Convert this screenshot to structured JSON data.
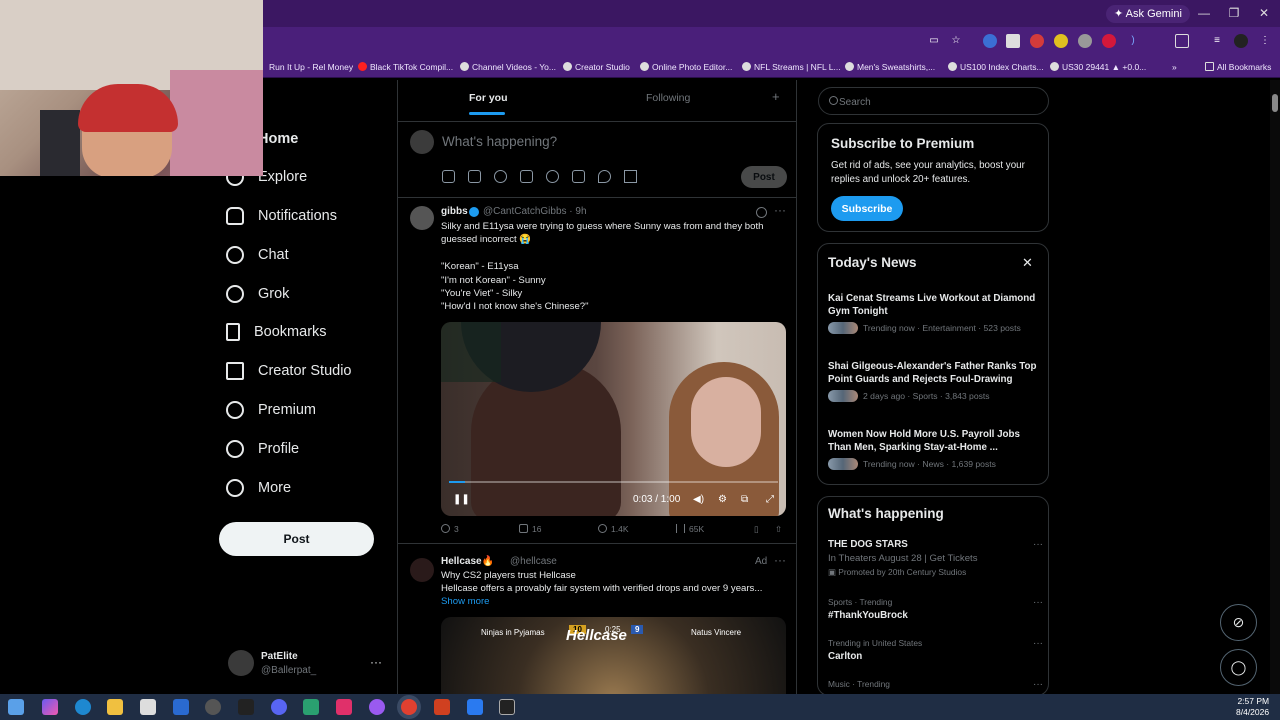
{
  "browser": {
    "gemini_label": "Ask Gemini",
    "bookmarks": [
      "Run It Up - Rel Money",
      "Black TikTok Compil...",
      "Channel Videos - Yo...",
      "Creator Studio",
      "Online Photo Editor...",
      "NFL Streams | NFL L...",
      "Men's Sweatshirts,...",
      "US100 Index Charts...",
      "US30 29441 ▲ +0.0...",
      "All Bookmarks"
    ]
  },
  "nav": {
    "items": [
      "Home",
      "Explore",
      "Notifications",
      "Chat",
      "Grok",
      "Bookmarks",
      "Creator Studio",
      "Premium",
      "Profile",
      "More"
    ],
    "post_label": "Post",
    "account_name": "PatElite",
    "account_handle": "@Ballerpat_"
  },
  "timeline": {
    "tabs": [
      "For you",
      "Following"
    ],
    "plus": "+",
    "compose_placeholder": "What's happening?",
    "compose_post": "Post",
    "tweet": {
      "name": "gibbs",
      "handle": "@CantCatchGibbs · 9h",
      "text": "Silky and E11ysa were trying to guess where Sunny was from and they both guessed incorrect 😭\n\n\"Korean\" - E11ysa\n\"I'm not Korean\" - Sunny\n\"You're Viet\" - Silky\n\"How'd I not know she's Chinese?\"",
      "video_time": "0:03 / 1:00",
      "video_progress": 0.05,
      "replies": "3",
      "reposts": "16",
      "likes": "1.4K",
      "views": "65K"
    },
    "ad": {
      "name": "Hellcase🔥",
      "handle": "@hellcase",
      "label": "Ad",
      "text": "Why CS2 players trust Hellcase\nHellcase offers a provably fair system with verified drops and over 9 years...",
      "show_more": "Show more",
      "hud_left": "Ninjas in Pyjamas",
      "hud_score_left": "10",
      "hud_clock": "0:25",
      "hud_score_right": "9",
      "hud_right": "Natus Vincere",
      "logo": "Hellcase"
    }
  },
  "sidebar": {
    "search_placeholder": "Search",
    "premium": {
      "title": "Subscribe to Premium",
      "body": "Get rid of ads, see your analytics, boost your replies and unlock 20+ features.",
      "button": "Subscribe"
    },
    "news": {
      "title": "Today's News",
      "items": [
        {
          "title": "Kai Cenat Streams Live Workout at Diamond Gym Tonight",
          "meta": "Trending now · Entertainment · 523 posts"
        },
        {
          "title": "Shai Gilgeous-Alexander's Father Ranks Top Point Guards and Rejects Foul-Drawing",
          "meta": "2 days ago · Sports · 3,843 posts"
        },
        {
          "title": "Women Now Hold More U.S. Payroll Jobs Than Men, Sparking Stay-at-Home ...",
          "meta": "Trending now · News · 1,639 posts"
        }
      ]
    },
    "happening": {
      "title": "What's happening",
      "items": [
        {
          "category": "",
          "title": "THE DOG STARS",
          "sub": "In Theaters August 28 | Get Tickets",
          "promo": "Promoted by 20th Century Studios"
        },
        {
          "category": "Sports · Trending",
          "title": "#ThankYouBrock",
          "sub": "",
          "promo": ""
        },
        {
          "category": "Trending in United States",
          "title": "Carlton",
          "sub": "",
          "promo": ""
        },
        {
          "category": "Music · Trending",
          "title": "",
          "sub": "",
          "promo": ""
        }
      ]
    }
  },
  "taskbar": {
    "time": "2:57 PM",
    "date": "8/4/2026"
  }
}
